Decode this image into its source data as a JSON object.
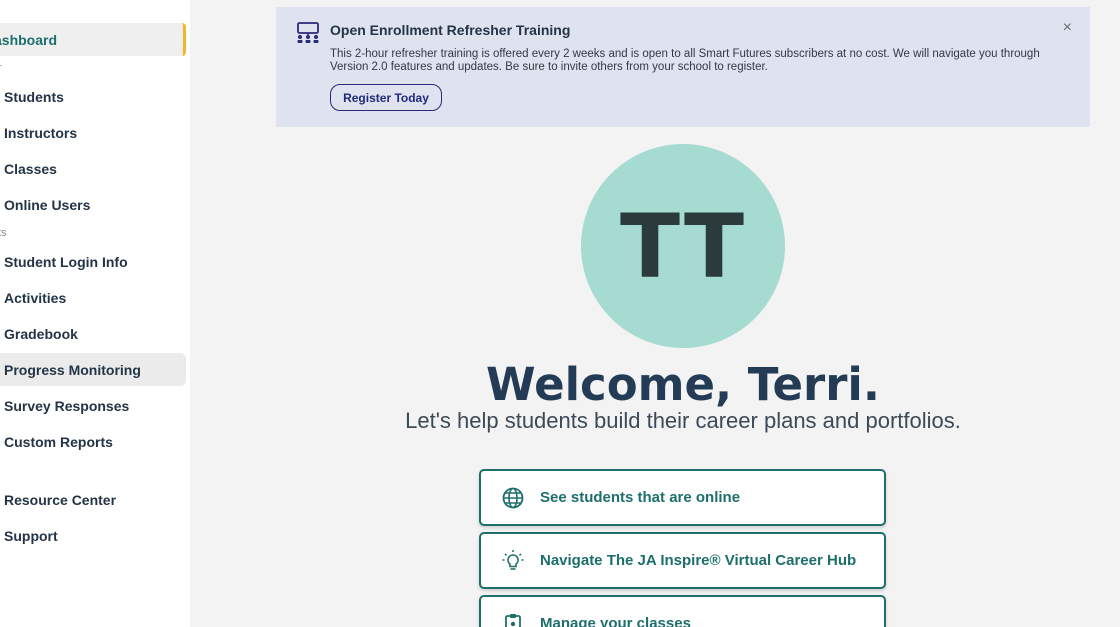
{
  "sidebar": {
    "dashboard_label": "ashboard",
    "section1_label": "r",
    "section2_label": "ts",
    "items": [
      {
        "label": "Students"
      },
      {
        "label": "Instructors"
      },
      {
        "label": "Classes"
      },
      {
        "label": "Online Users"
      },
      {
        "label": "Student Login Info"
      },
      {
        "label": "Activities"
      },
      {
        "label": "Gradebook"
      },
      {
        "label": "Progress Monitoring"
      },
      {
        "label": "Survey Responses"
      },
      {
        "label": "Custom Reports"
      },
      {
        "label": "Resource Center"
      },
      {
        "label": "Support"
      }
    ]
  },
  "banner": {
    "title": "Open Enrollment Refresher Training",
    "text": "This 2-hour refresher training is offered every 2 weeks and is open to all Smart Futures subscribers at no cost. We will navigate you through Version 2.0 features and updates. Be sure to invite others from your school to register.",
    "button_label": "Register Today",
    "close_glyph": "×"
  },
  "avatar": {
    "initials": "TT",
    "color": "#a5dbd0"
  },
  "welcome": {
    "title": "Welcome, Terri.",
    "subtitle": "Let's help students build their career plans and portfolios."
  },
  "actions": [
    {
      "label": "See students that are online",
      "icon": "globe-icon"
    },
    {
      "label": "Navigate The JA Inspire® Virtual Career Hub",
      "icon": "lightbulb-icon"
    },
    {
      "label": "Manage your classes",
      "icon": "clipboard-icon"
    }
  ],
  "colors": {
    "accent": "#1d6f6c",
    "active_marker": "#f2b627",
    "banner_bg": "#dfe2ef"
  }
}
